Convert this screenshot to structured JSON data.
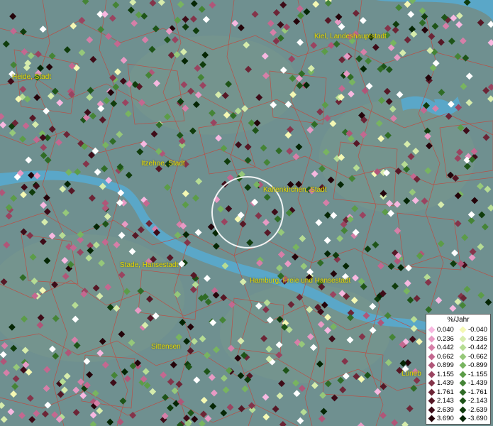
{
  "map": {
    "colors": {
      "land": "#6f9090",
      "water": "#5aa7c8",
      "borders": "#c4453a",
      "label": "#e6d800",
      "circle": "#ffffff"
    },
    "places": [
      {
        "id": "kiel",
        "label": "Kiel, Landeshauptstadt"
      },
      {
        "id": "heide",
        "label": "Heide, Stadt"
      },
      {
        "id": "itzehoe",
        "label": "Itzehoe, Stadt"
      },
      {
        "id": "kaltenkirchen",
        "label": "Kaltenkirchen, Stadt"
      },
      {
        "id": "stade",
        "label": "Stade, Hansestadt"
      },
      {
        "id": "hamburg",
        "label": "Hamburg, Freie und Hansestadt"
      },
      {
        "id": "sittensen",
        "label": "Sittensen"
      },
      {
        "id": "lueneburg",
        "label": "Lüneb"
      }
    ]
  },
  "legend": {
    "title": "%/Jahr",
    "positive": [
      {
        "value": "0.040",
        "color": "#f7b8e0"
      },
      {
        "value": "0.236",
        "color": "#e89ac4"
      },
      {
        "value": "0.442",
        "color": "#d67fa8"
      },
      {
        "value": "0.662",
        "color": "#c46890"
      },
      {
        "value": "0.899",
        "color": "#b05678"
      },
      {
        "value": "1.155",
        "color": "#9a4460"
      },
      {
        "value": "1.439",
        "color": "#84344a"
      },
      {
        "value": "1.761",
        "color": "#6c2536"
      },
      {
        "value": "2.143",
        "color": "#561826"
      },
      {
        "value": "2.639",
        "color": "#3e0c18"
      },
      {
        "value": "3.690",
        "color": "#24040a"
      }
    ],
    "negative": [
      {
        "value": "-0.040",
        "color": "#f4f8b4"
      },
      {
        "value": "-0.236",
        "color": "#d6ecac"
      },
      {
        "value": "-0.442",
        "color": "#b6dc94"
      },
      {
        "value": "-0.662",
        "color": "#96c87a"
      },
      {
        "value": "-0.899",
        "color": "#78b460"
      },
      {
        "value": "-1.155",
        "color": "#5c9c48"
      },
      {
        "value": "-1.439",
        "color": "#458436"
      },
      {
        "value": "-1.761",
        "color": "#306c26"
      },
      {
        "value": "-2.143",
        "color": "#1e5418"
      },
      {
        "value": "-2.639",
        "color": "#103c0c"
      },
      {
        "value": "-3.690",
        "color": "#052604"
      }
    ]
  }
}
